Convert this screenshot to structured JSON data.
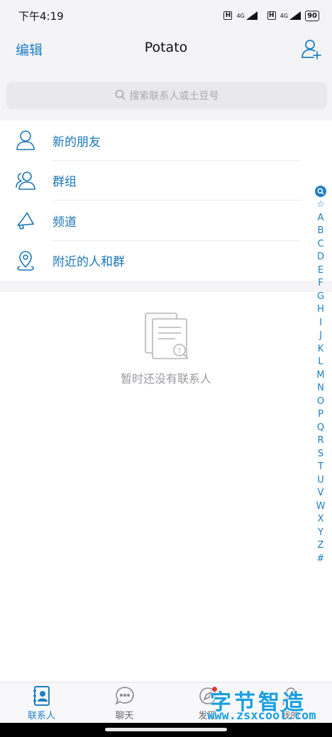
{
  "status_bar": {
    "time": "下午4:19",
    "signal1_label": "4G",
    "signal2_label": "4G",
    "hd1": "H",
    "hd2": "H",
    "battery": "90"
  },
  "header": {
    "edit_label": "编辑",
    "title": "Potato",
    "add_contact_icon": "add-contact-icon"
  },
  "search": {
    "placeholder": "搜索联系人或土豆号"
  },
  "menu": [
    {
      "label": "新的朋友",
      "icon": "person-icon"
    },
    {
      "label": "群组",
      "icon": "group-icon"
    },
    {
      "label": "频道",
      "icon": "megaphone-icon"
    },
    {
      "label": "附近的人和群",
      "icon": "location-pin-icon"
    }
  ],
  "empty_state": {
    "text": "暂时还没有联系人"
  },
  "index_bar": [
    "☆",
    "A",
    "B",
    "C",
    "D",
    "E",
    "F",
    "G",
    "H",
    "I",
    "J",
    "K",
    "L",
    "M",
    "N",
    "O",
    "P",
    "Q",
    "R",
    "S",
    "T",
    "U",
    "V",
    "W",
    "X",
    "Y",
    "Z",
    "#"
  ],
  "tabs": [
    {
      "label": "联系人",
      "active": true
    },
    {
      "label": "聊天",
      "active": false
    },
    {
      "label": "发现",
      "active": false
    },
    {
      "label": "我的",
      "active": false
    }
  ],
  "watermark": {
    "title": "字节智造",
    "url": "www.zsxcool.com"
  },
  "colors": {
    "accent": "#1f7fc4",
    "background_gray": "#f4f4f6",
    "notification_dot": "#e03b3b"
  }
}
